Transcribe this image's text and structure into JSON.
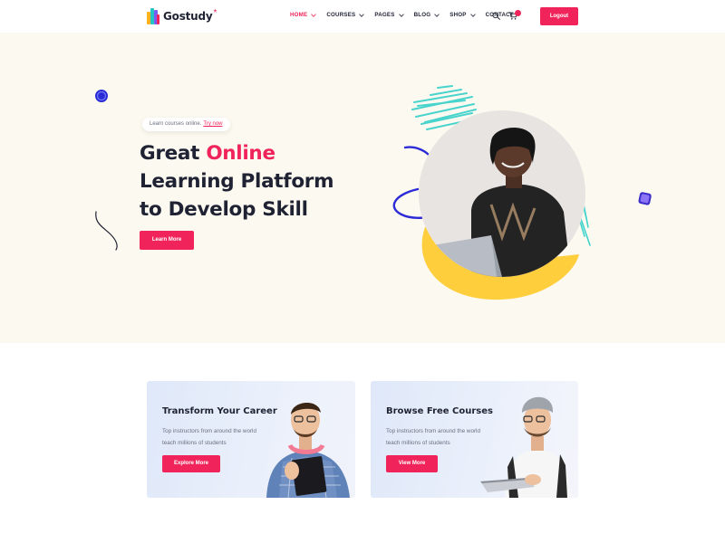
{
  "brand": {
    "name": "Gostudy",
    "mark": "*",
    "accent": "#f0245a"
  },
  "nav": {
    "items": [
      {
        "label": "HOME",
        "dropdown": true,
        "active": true
      },
      {
        "label": "COURSES",
        "dropdown": true
      },
      {
        "label": "PAGES",
        "dropdown": true
      },
      {
        "label": "BLOG",
        "dropdown": true
      },
      {
        "label": "SHOP",
        "dropdown": true
      },
      {
        "label": "CONTACT",
        "dropdown": false
      }
    ],
    "cart_count": "",
    "logout_label": "Logout"
  },
  "hero": {
    "pill_text": "Learn courses online.",
    "pill_link": "Try now",
    "title_part1": "Great ",
    "title_accent": "Online",
    "title_line2": "Learning Platform",
    "title_line3": "to Develop Skill",
    "button_label": "Learn More"
  },
  "cards": [
    {
      "title": "Transform Your Career",
      "text": "Top instructors from around the world teach millions of students",
      "button": "Explore More"
    },
    {
      "title": "Browse Free Courses",
      "text": "Top instructors from around the world teach millions of students",
      "button": "View More"
    }
  ]
}
